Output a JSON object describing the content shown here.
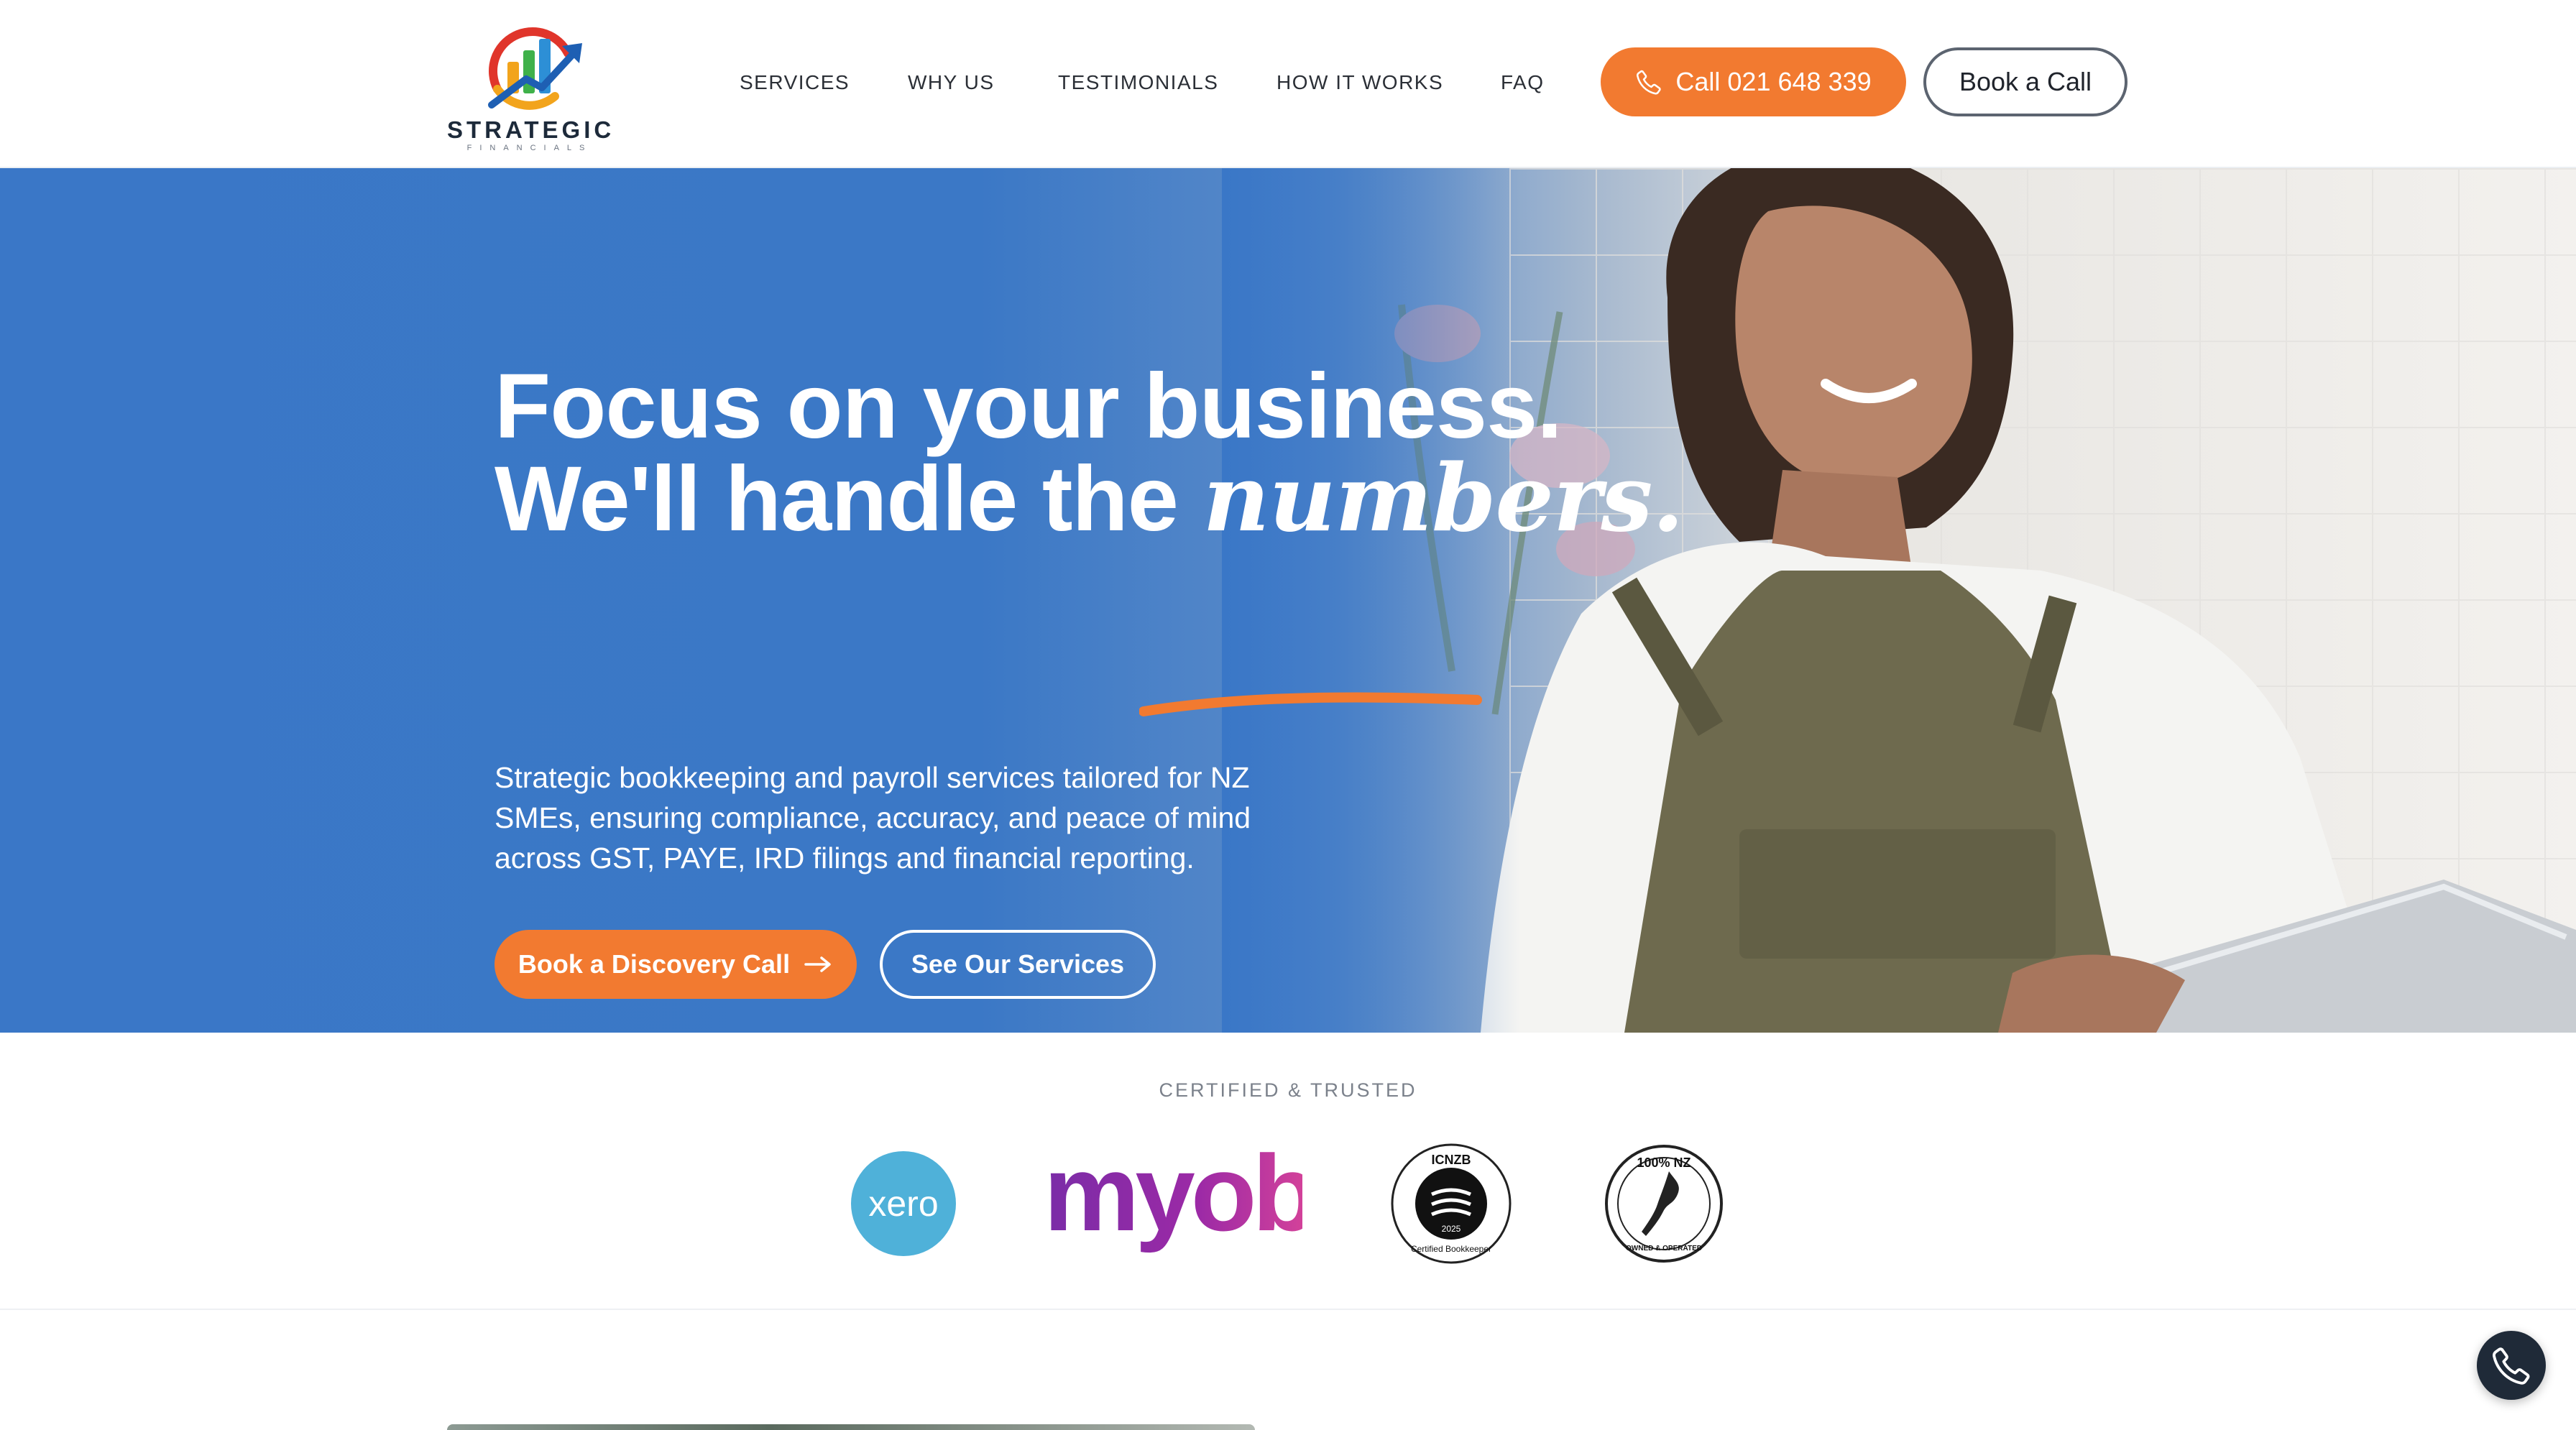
{
  "header": {
    "logo": {
      "word": "STRATEGIC",
      "sub": "FINANCIALS"
    },
    "nav": [
      "SERVICES",
      "WHY US",
      "TESTIMONIALS",
      "HOW IT WORKS",
      "FAQ"
    ],
    "call_label": "Call 021 648 339",
    "book_label": "Book a Call"
  },
  "hero": {
    "title_line1": "Focus on your business.",
    "title_line2_prefix": "We'll handle the ",
    "title_line2_emphasis": "numbers.",
    "subtitle": "Strategic bookkeeping and payroll services tailored for NZ SMEs, ensuring compliance, accuracy, and peace of mind across GST, PAYE, IRD filings and financial reporting.",
    "cta_primary": "Book a Discovery Call",
    "cta_secondary": "See Our Services"
  },
  "trust": {
    "label": "CERTIFIED & TRUSTED",
    "logos": {
      "xero": "xero",
      "myob": "myob",
      "icnzb_top": "ICNZB",
      "icnzb_bottom": "Certified Bookkeeper",
      "icnzb_year": "2025",
      "nz_top": "100% NZ",
      "nz_bottom": "OWNED & OPERATED"
    }
  },
  "colors": {
    "accent": "#f27a30",
    "hero_blue": "#3a77c7",
    "dark": "#1f2a38"
  },
  "icons": {
    "call": "phone-icon",
    "arrow": "arrow-right-icon",
    "floating": "phone-icon"
  }
}
